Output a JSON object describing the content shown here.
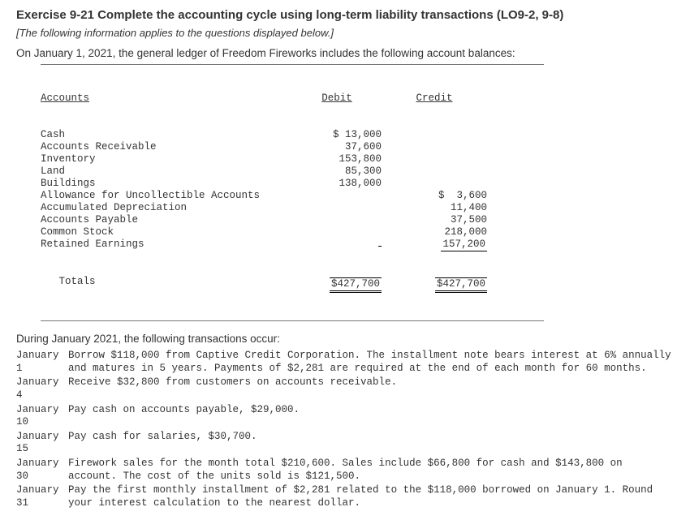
{
  "header": {
    "title": "Exercise 9-21 Complete the accounting cycle using long-term liability transactions (LO9-2, 9-8)",
    "subtitle": "[The following information applies to the questions displayed below.]",
    "intro": "On January 1, 2021, the general ledger of Freedom Fireworks includes the following account balances:"
  },
  "ledger": {
    "col_accounts": "Accounts",
    "col_debit": "Debit",
    "col_credit": "Credit",
    "rows": [
      {
        "name": "Cash",
        "debit": "$ 13,000",
        "credit": ""
      },
      {
        "name": "Accounts Receivable",
        "debit": "37,600",
        "credit": ""
      },
      {
        "name": "Inventory",
        "debit": "153,800",
        "credit": ""
      },
      {
        "name": "Land",
        "debit": "85,300",
        "credit": ""
      },
      {
        "name": "Buildings",
        "debit": "138,000",
        "credit": ""
      },
      {
        "name": "Allowance for Uncollectible Accounts",
        "debit": "",
        "credit": "$  3,600"
      },
      {
        "name": "Accumulated Depreciation",
        "debit": "",
        "credit": "11,400"
      },
      {
        "name": "Accounts Payable",
        "debit": "",
        "credit": "37,500"
      },
      {
        "name": "Common Stock",
        "debit": "",
        "credit": "218,000"
      },
      {
        "name": "Retained Earnings",
        "debit": "",
        "credit": "157,200"
      }
    ],
    "totals_label": "Totals",
    "total_debit": "$427,700",
    "total_credit": "$427,700"
  },
  "txn_intro": "During January 2021, the following transactions occur:",
  "txns": [
    {
      "date": "January 1",
      "text": "Borrow $118,000 from Captive Credit Corporation. The installment note bears interest at 6% annually and matures in 5 years. Payments of $2,281 are required at the end of each month for 60 months."
    },
    {
      "date": "January 4",
      "text": "Receive $32,800 from customers on accounts receivable."
    },
    {
      "date": "January 10",
      "text": "Pay cash on accounts payable, $29,000."
    },
    {
      "date": "January 15",
      "text": "Pay cash for salaries, $30,700."
    },
    {
      "date": "January 30",
      "text": "Firework sales for the month total $210,600. Sales include $66,800 for cash and $143,800 on account. The cost of the units sold is $121,500."
    },
    {
      "date": "January 31",
      "text": "Pay the first monthly installment of $2,281 related to the $118,000 borrowed on January 1. Round your interest calculation to the nearest dollar."
    }
  ]
}
